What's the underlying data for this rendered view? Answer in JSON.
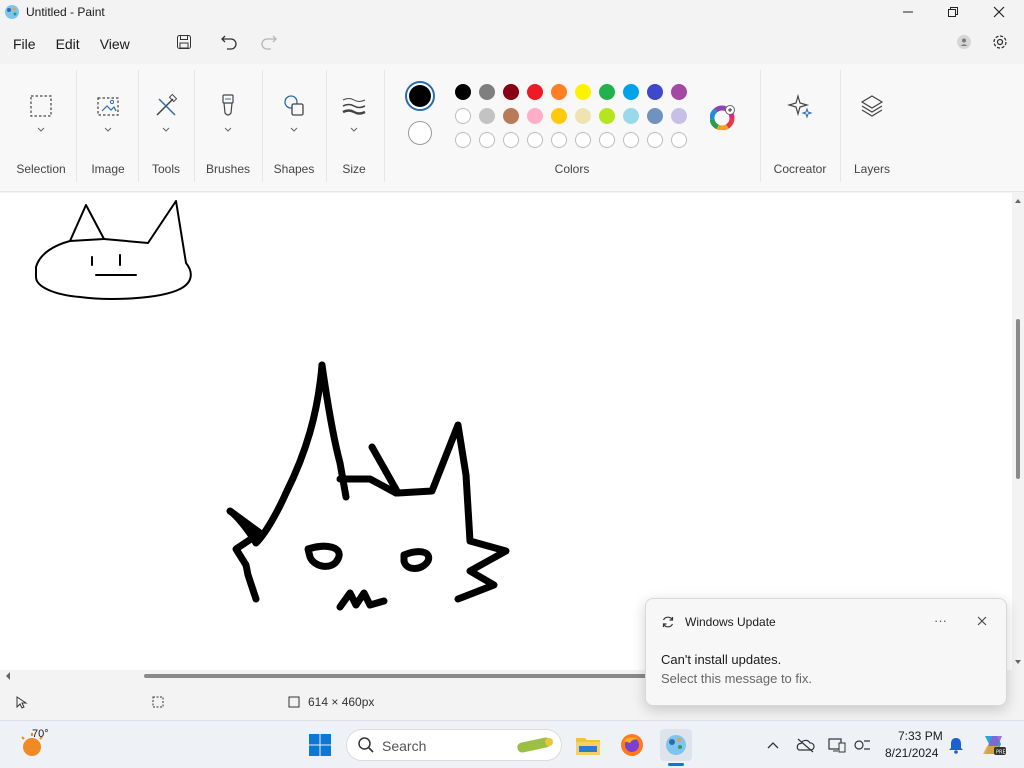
{
  "window": {
    "title": "Untitled - Paint"
  },
  "menu": {
    "file": "File",
    "edit": "Edit",
    "view": "View"
  },
  "ribbon": {
    "groups": {
      "selection": "Selection",
      "image": "Image",
      "tools": "Tools",
      "brushes": "Brushes",
      "shapes": "Shapes",
      "size": "Size",
      "colors": "Colors",
      "cocreator": "Cocreator",
      "layers": "Layers"
    },
    "palette_row1": [
      "#000000",
      "#7f7f7f",
      "#880015",
      "#ed1c24",
      "#ff7f27",
      "#fff200",
      "#22b14c",
      "#00a2e8",
      "#3f48cc",
      "#a349a4"
    ],
    "palette_row2": [
      "#ffffff",
      "#c3c3c3",
      "#b97a57",
      "#ffaec9",
      "#ffc90e",
      "#efe4b0",
      "#b5e61d",
      "#99d9ea",
      "#7092be",
      "#c8bfe7"
    ],
    "primary_color": "#000000",
    "secondary_color": "#ffffff"
  },
  "status": {
    "canvas_size": "614 × 460px"
  },
  "toast": {
    "title": "Windows Update",
    "message": "Can't install updates.",
    "sub": "Select this message to fix.",
    "more": "···"
  },
  "taskbar": {
    "weather": "70°",
    "search_placeholder": "Search",
    "time": "7:33 PM",
    "date": "8/21/2024"
  }
}
